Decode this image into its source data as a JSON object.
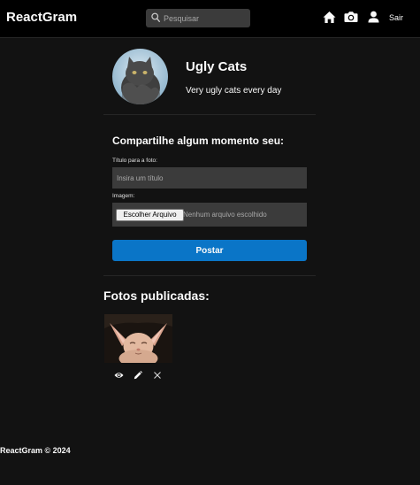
{
  "navbar": {
    "brand": "ReactGram",
    "search_placeholder": "Pesquisar",
    "icons": [
      "home-icon",
      "camera-icon",
      "user-icon"
    ],
    "logout_label": "Sair"
  },
  "profile": {
    "name": "Ugly Cats",
    "bio": "Very ugly cats every day"
  },
  "upload_form": {
    "heading": "Compartilhe algum momento seu:",
    "title_label": "Título para a foto:",
    "title_placeholder": "Insira um título",
    "image_label": "Imagem:",
    "file_button": "Escolher Arquivo",
    "file_status": "Nenhum arquivo escolhido",
    "submit_label": "Postar"
  },
  "photos": {
    "heading": "Fotos publicadas:",
    "items": [
      {
        "actions": [
          "eye-icon",
          "pencil-icon",
          "close-icon"
        ]
      }
    ]
  },
  "footer": {
    "text": "ReactGram © 2024"
  },
  "colors": {
    "background": "#121212",
    "navbar": "#000000",
    "input": "#3b3b3b",
    "primary_button": "#0a75c7",
    "text": "#fafafa"
  }
}
